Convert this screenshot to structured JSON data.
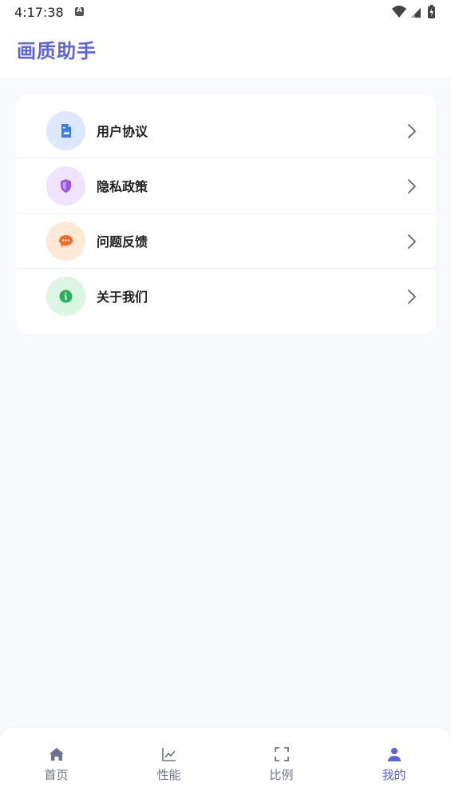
{
  "status_bar": {
    "time": "4:17:38"
  },
  "header": {
    "title": "画质助手",
    "title_color": "#5B63E6"
  },
  "menu": {
    "items": [
      {
        "label": "用户协议",
        "icon": "document-icon",
        "icon_color": "#3B7BEA",
        "icon_bg": "#DCE8FD"
      },
      {
        "label": "隐私政策",
        "icon": "shield-icon",
        "icon_color": "#9A52E8",
        "icon_bg": "#EFE3FD"
      },
      {
        "label": "问题反馈",
        "icon": "chat-bubble-icon",
        "icon_color": "#F06A2A",
        "icon_bg": "#FDE9D6"
      },
      {
        "label": "关于我们",
        "icon": "info-icon",
        "icon_color": "#22B457",
        "icon_bg": "#DBF7E4"
      }
    ]
  },
  "bottom_nav": {
    "active_color": "#5B63E6",
    "inactive_color": "#6B7390",
    "items": [
      {
        "label": "首页",
        "icon": "home-icon"
      },
      {
        "label": "性能",
        "icon": "line-chart-icon"
      },
      {
        "label": "比例",
        "icon": "fullscreen-icon"
      },
      {
        "label": "我的",
        "icon": "user-icon"
      }
    ],
    "active_index": 3
  }
}
